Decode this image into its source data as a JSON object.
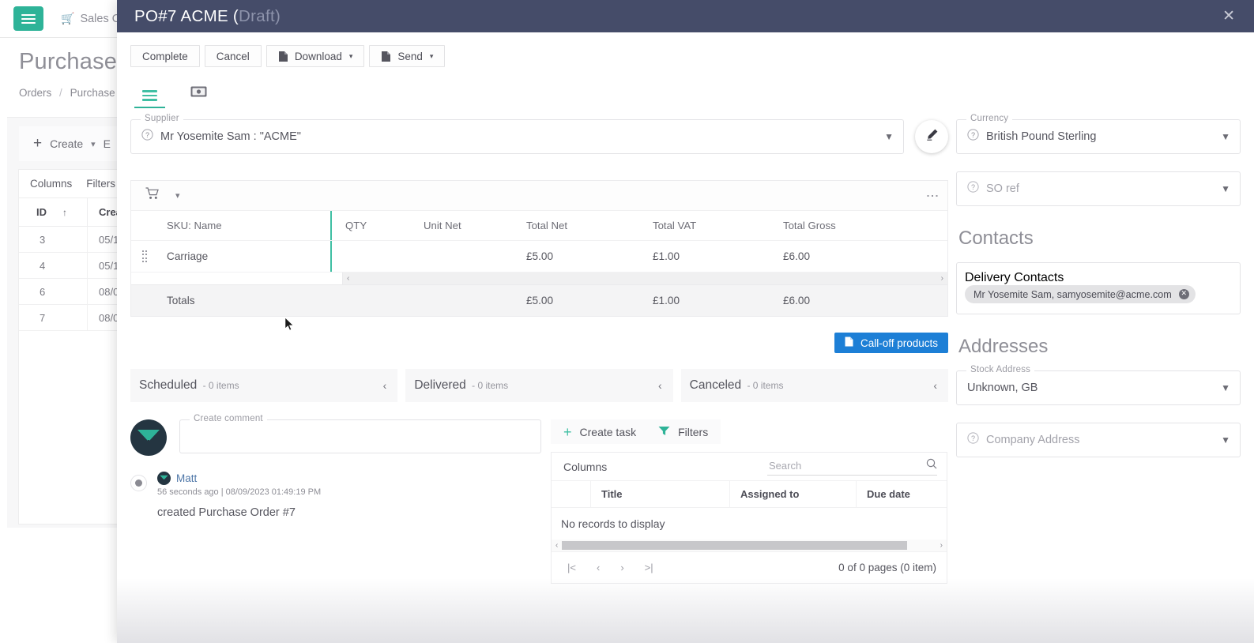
{
  "background": {
    "menu_icon": "hamburger-menu-icon",
    "nav_label": "Sales Orde",
    "nav_icon": "cart-icon",
    "page_title": "Purchase Or",
    "breadcrumb": {
      "root": "Orders",
      "sep": "/",
      "current": "Purchase"
    },
    "toolbar": {
      "create_label": "Create",
      "plus": "+",
      "export_label": "E"
    },
    "grid_tools": {
      "columns": "Columns",
      "filters": "Filters"
    },
    "grid": {
      "columns": [
        "ID",
        "Crea"
      ],
      "sort_arrow": "↑",
      "rows": [
        {
          "id": "3",
          "created": "05/1"
        },
        {
          "id": "4",
          "created": "05/1"
        },
        {
          "id": "6",
          "created": "08/0"
        },
        {
          "id": "7",
          "created": "08/0"
        }
      ]
    }
  },
  "modal": {
    "title_main": "PO#7 ACME (",
    "title_state": "Draft)",
    "close_icon": "close-icon",
    "actions": [
      {
        "label": "Complete",
        "icon": null,
        "caret": false
      },
      {
        "label": "Cancel",
        "icon": null,
        "caret": false
      },
      {
        "label": "Download",
        "icon": "document-icon",
        "caret": true
      },
      {
        "label": "Send",
        "icon": "document-icon",
        "caret": true
      }
    ],
    "caret_glyph": "▾",
    "tabs": [
      {
        "name": "details-tab",
        "icon": "list-lines-icon",
        "active": true
      },
      {
        "name": "financials-tab",
        "icon": "banknote-icon",
        "active": false
      }
    ],
    "supplier": {
      "label": "Supplier",
      "value": "Mr Yosemite Sam : \"ACME\"",
      "help_icon": "question-circle-icon",
      "dropdown_icon": "chevron-down-icon",
      "edit_icon": "pencil-edit-icon"
    },
    "products": {
      "toolbar": {
        "cart_icon": "cart-icon",
        "chevron_icon": "chevron-down-icon",
        "kebab_icon": "more-vertical-icon"
      },
      "columns": [
        "SKU: Name",
        "QTY",
        "Unit Net",
        "Total Net",
        "Total VAT",
        "Total Gross"
      ],
      "rows": [
        {
          "drag_icon": "drag-handle-icon",
          "sku": "Carriage",
          "qty": "",
          "unit_net": "",
          "total_net": "£5.00",
          "total_vat": "£1.00",
          "total_gross": "£6.00"
        }
      ],
      "totals": {
        "label": "Totals",
        "total_net": "£5.00",
        "total_vat": "£1.00",
        "total_gross": "£6.00"
      },
      "scroll_left_icon": "chevron-left-icon",
      "scroll_right_icon": "chevron-right-icon"
    },
    "calloff_button": {
      "label": "Call-off products",
      "icon": "document-icon",
      "color": "#1d7fd6"
    },
    "status_panels": [
      {
        "label": "Scheduled",
        "count": "- 0 items",
        "chevron": "‹"
      },
      {
        "label": "Delivered",
        "count": "- 0 items",
        "chevron": "‹"
      },
      {
        "label": "Canceled",
        "count": "- 0 items",
        "chevron": "‹"
      }
    ],
    "comments": {
      "avatar_icon": "user-avatar-icon",
      "comment_label": "Create comment",
      "comment_value": "",
      "feed": [
        {
          "author": "Matt",
          "meta": "56 seconds ago | 08/09/2023 01:49:19 PM",
          "text": "created Purchase Order #7"
        }
      ]
    },
    "tasks": {
      "create_task": {
        "label": "Create task",
        "icon": "plus-icon"
      },
      "filters": {
        "label": "Filters",
        "icon": "funnel-filter-icon"
      },
      "columns_label": "Columns",
      "search": {
        "placeholder": "Search",
        "value": "",
        "icon": "search-icon"
      },
      "table_columns": [
        "Title",
        "Assigned to",
        "Due date"
      ],
      "empty_text": "No records to display",
      "pager": {
        "first": "|<",
        "prev": "‹",
        "next": "›",
        "last": ">|",
        "count": "0 of 0 pages (0 item)"
      }
    },
    "sidebar": {
      "currency": {
        "label": "Currency",
        "value": "British Pound Sterling",
        "help_icon": "question-circle-icon",
        "dropdown_icon": "chevron-down-icon"
      },
      "so_ref": {
        "label": "",
        "placeholder": "SO ref",
        "value": "",
        "help_icon": "question-circle-icon",
        "dropdown_icon": "chevron-down-icon"
      },
      "contacts_title": "Contacts",
      "delivery_contacts": {
        "label": "Delivery Contacts",
        "chips": [
          {
            "text": "Mr Yosemite Sam, samyosemite@acme.com",
            "remove_icon": "remove-chip-icon"
          }
        ]
      },
      "addresses_title": "Addresses",
      "stock_address": {
        "label": "Stock Address",
        "value": "Unknown, GB",
        "dropdown_icon": "chevron-down-icon"
      },
      "company_address": {
        "label": "",
        "placeholder": "Company Address",
        "value": "",
        "help_icon": "question-circle-icon",
        "dropdown_icon": "chevron-down-icon"
      }
    }
  },
  "theme": {
    "accent_green": "#2eb398",
    "header_navy": "#454c69",
    "link_blue": "#4f77a8",
    "button_blue": "#1d7fd6"
  }
}
